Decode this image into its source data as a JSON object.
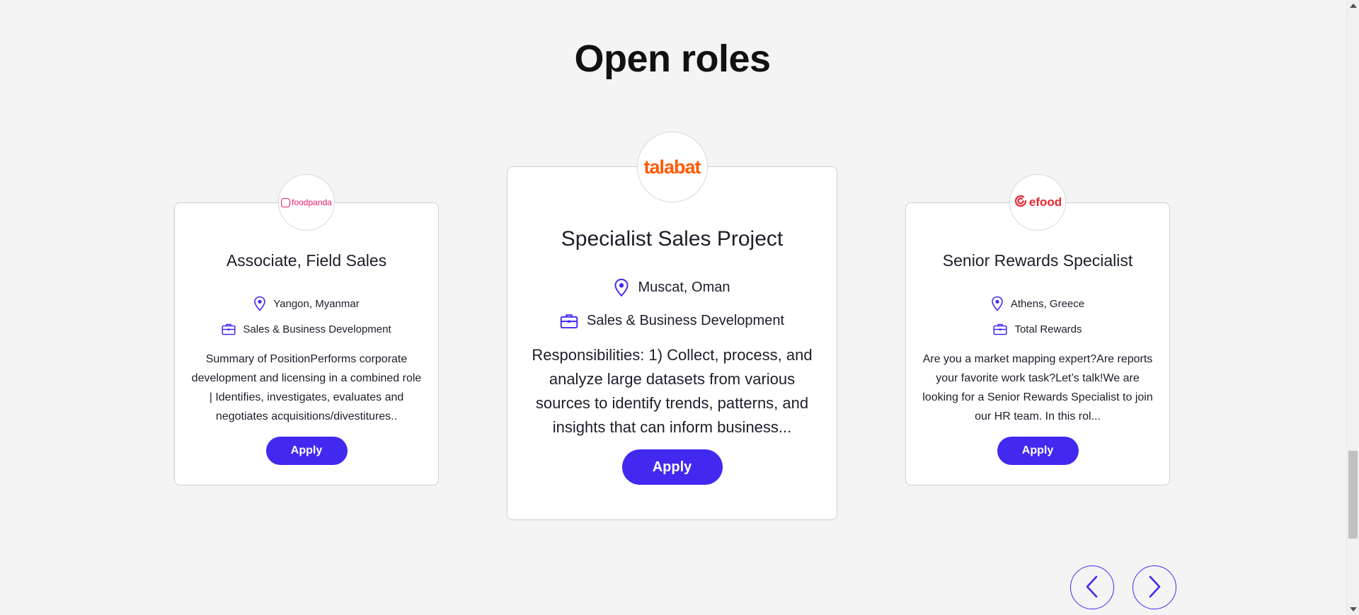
{
  "section": {
    "title": "Open roles"
  },
  "jobs": [
    {
      "brand": "foodpanda",
      "brand_color": "#e21b70",
      "title": "Associate, Field Sales",
      "location": "Yangon, Myanmar",
      "department": "Sales & Business Development",
      "description": "Summary of PositionPerforms corporate development and licensing in a combined role | Identifies, investigates, evaluates and negotiates acquisitions/divestitures..",
      "apply_label": "Apply"
    },
    {
      "brand": "talabat",
      "brand_color": "#ff5a00",
      "title": "Specialist Sales Project",
      "location": "Muscat, Oman",
      "department": "Sales & Business Development",
      "description": "Responsibilities: 1) Collect, process, and analyze large datasets from various sources to identify trends, patterns, and insights that can inform business...",
      "apply_label": "Apply"
    },
    {
      "brand": "efood",
      "brand_color": "#e8262f",
      "title": "Senior Rewards Specialist",
      "location": "Athens, Greece",
      "department": "Total Rewards",
      "description": "Are you a market mapping expert?Are reports your favorite work task?Let’s talk!We are looking for a Senior Rewards Specialist to join our HR team. In this rol...",
      "apply_label": "Apply"
    }
  ],
  "carousel": {
    "prev_icon": "chevron-left-icon",
    "next_icon": "chevron-right-icon"
  },
  "colors": {
    "accent": "#4229f0",
    "background": "#f4f4f4"
  }
}
